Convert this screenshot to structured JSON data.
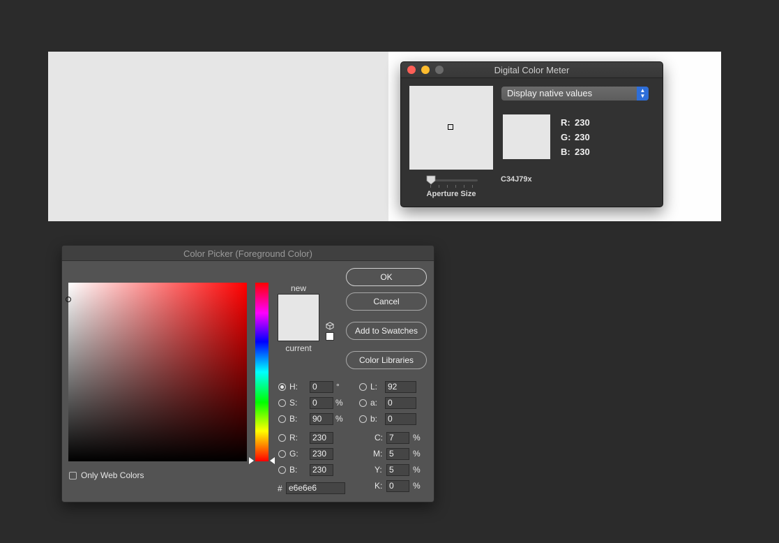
{
  "meter": {
    "title": "Digital Color Meter",
    "display_mode": "Display native values",
    "aperture_label": "Aperture Size",
    "aperture_level": 0.0,
    "r_label": "R:",
    "r_value": "230",
    "g_label": "G:",
    "g_value": "230",
    "b_label": "B:",
    "b_value": "230",
    "code": "C34J79x",
    "sampled_color": "#e6e6e6"
  },
  "picker": {
    "title": "Color Picker (Foreground Color)",
    "new_label": "new",
    "current_label": "current",
    "buttons": {
      "ok": "OK",
      "cancel": "Cancel",
      "add_to_swatches": "Add to Swatches",
      "color_libraries": "Color Libraries"
    },
    "hsb": {
      "h_label": "H:",
      "h_value": "0",
      "h_unit": "°",
      "s_label": "S:",
      "s_value": "0",
      "s_unit": "%",
      "b_label": "B:",
      "b_value": "90",
      "b_unit": "%"
    },
    "rgb": {
      "r_label": "R:",
      "r_value": "230",
      "g_label": "G:",
      "g_value": "230",
      "b_label": "B:",
      "b_value": "230"
    },
    "lab": {
      "l_label": "L:",
      "l_value": "92",
      "a_label": "a:",
      "a_value": "0",
      "b_label": "b:",
      "b_value": "0"
    },
    "cmyk": {
      "c_label": "C:",
      "c_value": "7",
      "c_unit": "%",
      "m_label": "M:",
      "m_value": "5",
      "m_unit": "%",
      "y_label": "Y:",
      "y_value": "5",
      "y_unit": "%",
      "k_label": "K:",
      "k_value": "0",
      "k_unit": "%"
    },
    "hex_label": "#",
    "hex_value": "e6e6e6",
    "only_web_colors_label": "Only Web Colors",
    "selected_mode": "H",
    "new_color": "#e6e6e6"
  }
}
